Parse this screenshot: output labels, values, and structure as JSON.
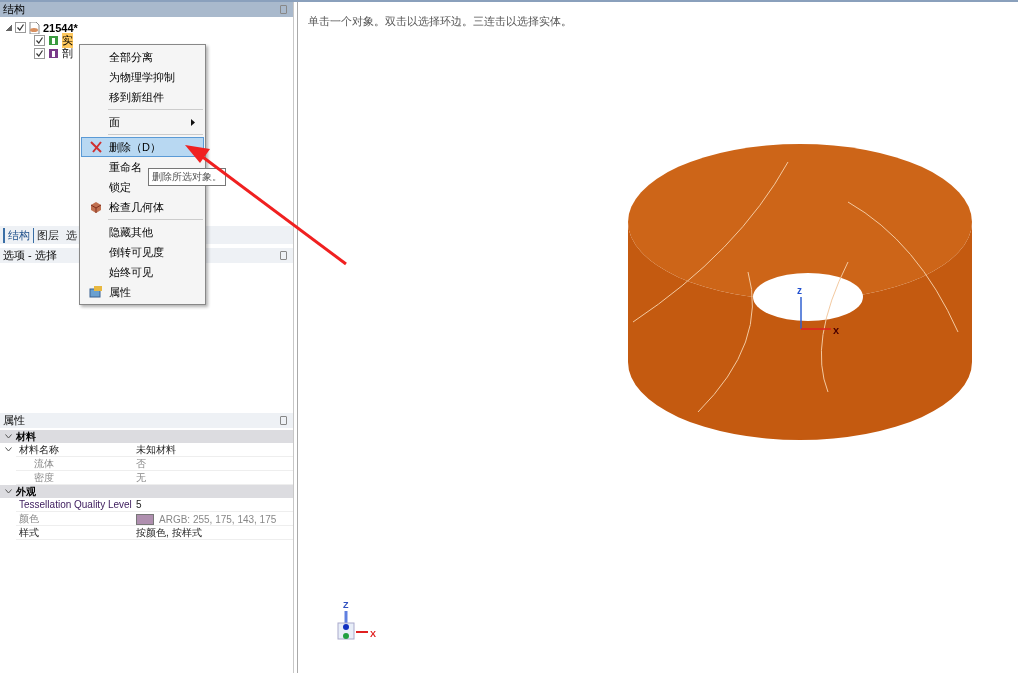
{
  "structure_panel": {
    "title": "结构"
  },
  "tree": {
    "label": "21544*",
    "checked": true,
    "expanded": true,
    "children": [
      {
        "label": "实",
        "checked": true,
        "selected": true
      },
      {
        "label": "剖",
        "checked": true,
        "selected": false
      }
    ]
  },
  "context_menu": [
    {
      "kind": "item",
      "label": "全部分离"
    },
    {
      "kind": "item",
      "label": "为物理学抑制"
    },
    {
      "kind": "item",
      "label": "移到新组件"
    },
    {
      "kind": "separator"
    },
    {
      "kind": "submenu",
      "label": "面"
    },
    {
      "kind": "separator"
    },
    {
      "kind": "item",
      "label": "删除（D）",
      "highlighted": true
    },
    {
      "kind": "item",
      "label": "重命名"
    },
    {
      "kind": "item",
      "label": "锁定"
    },
    {
      "kind": "item",
      "label": "检查几何体"
    },
    {
      "kind": "separator"
    },
    {
      "kind": "item",
      "label": "隐藏其他"
    },
    {
      "kind": "item",
      "label": "倒转可见度"
    },
    {
      "kind": "item",
      "label": "始终可见"
    },
    {
      "kind": "item",
      "label": "属性"
    }
  ],
  "tooltip": "删除所选对象。",
  "tabs": [
    {
      "label": "结构",
      "selected": true
    },
    {
      "label": "图层",
      "selected": false
    },
    {
      "label": "选",
      "selected": false
    }
  ],
  "options_panel": {
    "title": "选项 - 选择"
  },
  "properties": {
    "title": "属性",
    "groups": [
      {
        "label": "材料",
        "expanded": true,
        "rows": [
          {
            "name": "材料名称",
            "value": "未知材料",
            "disabled": false,
            "expanded": true,
            "children": [
              {
                "name": "流体",
                "value": "否",
                "disabled": true
              },
              {
                "name": "密度",
                "value": "无",
                "disabled": true
              }
            ]
          }
        ]
      },
      {
        "label": "外观",
        "expanded": true,
        "rows": [
          {
            "name": "Tessellation Quality Level",
            "value": "5",
            "disabled": false
          },
          {
            "name": "颜色",
            "value": "ARGB: 255, 175, 143, 175",
            "disabled": true,
            "color": "#af8faf"
          },
          {
            "name": "样式",
            "value": "按颜色, 按样式",
            "disabled": false
          }
        ]
      }
    ]
  },
  "viewport": {
    "hint": "单击一个对象。双击以选择环边。三连击以选择实体。",
    "center_axis": [
      "z",
      "x"
    ],
    "triad": [
      "Z",
      "X"
    ]
  }
}
